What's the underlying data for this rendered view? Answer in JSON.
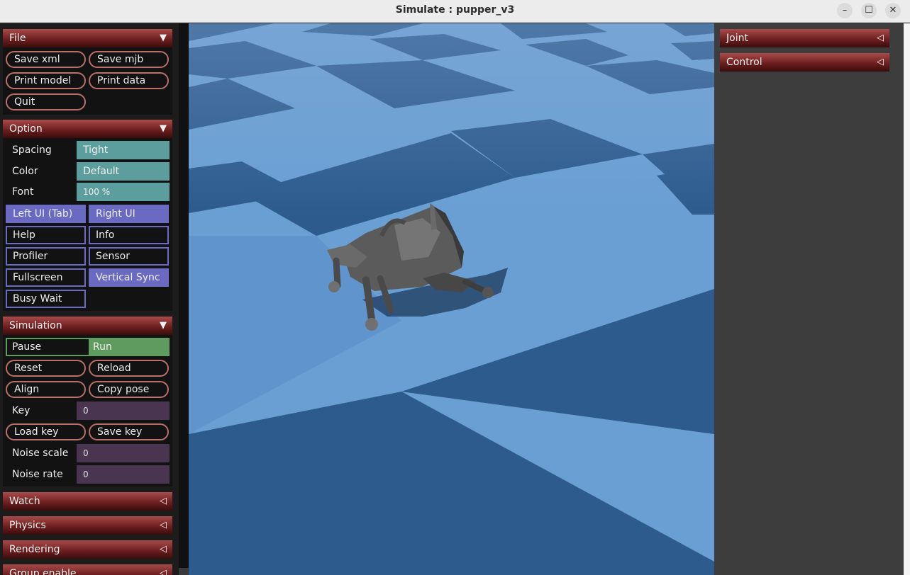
{
  "window": {
    "title": "Simulate : pupper_v3",
    "minimize": "–",
    "maximize": "☐",
    "close": "✕"
  },
  "file": {
    "title": "File",
    "buttons": [
      "Save xml",
      "Save mjb",
      "Print model",
      "Print data",
      "Quit"
    ]
  },
  "option": {
    "title": "Option",
    "spacing_label": "Spacing",
    "spacing_value": "Tight",
    "color_label": "Color",
    "color_value": "Default",
    "font_label": "Font",
    "font_value": "100 %",
    "toggles": [
      "Left UI (Tab)",
      "Right UI",
      "Help",
      "Info",
      "Profiler",
      "Sensor",
      "Fullscreen",
      "Vertical Sync",
      "Busy Wait"
    ],
    "toggles_on": [
      "Left UI (Tab)",
      "Right UI",
      "Vertical Sync"
    ]
  },
  "simulation": {
    "title": "Simulation",
    "pause": "Pause",
    "run": "Run",
    "run_active": true,
    "buttons": [
      "Reset",
      "Reload",
      "Align",
      "Copy pose"
    ],
    "key_label": "Key",
    "key_value": "0",
    "load_key": "Load key",
    "save_key": "Save key",
    "noise_scale_label": "Noise scale",
    "noise_scale_value": "0",
    "noise_rate_label": "Noise rate",
    "noise_rate_value": "0"
  },
  "collapsed_sections": [
    "Watch",
    "Physics",
    "Rendering",
    "Group enable"
  ],
  "right_sections": [
    "Joint",
    "Control"
  ],
  "colors": {
    "header_red": "#7a2424",
    "teal": "#5c9e9e",
    "purple": "#6a6ac2",
    "run_green": "#5f9a5f",
    "floor_light": "#6a9fd4",
    "floor_dark": "#2d5b8e"
  }
}
